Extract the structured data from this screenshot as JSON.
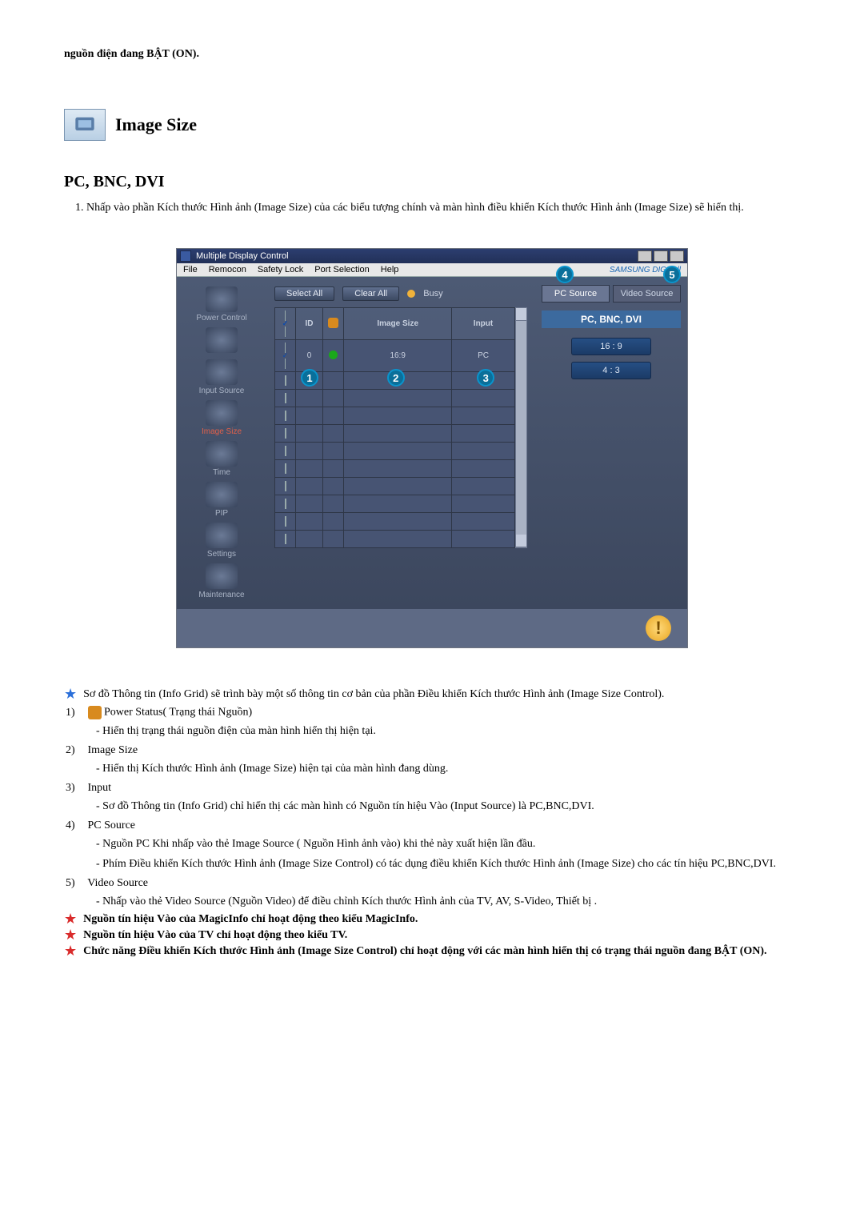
{
  "intro": "nguồn điện đang BẬT (ON).",
  "section": {
    "title": "Image Size",
    "subheading": "PC, BNC, DVI",
    "item1": "Nhấp vào phần Kích thước Hình ảnh (Image Size) của các biểu tượng chính và màn hình điều khiển Kích thước Hình ảnh (Image Size) sẽ hiển thị."
  },
  "app": {
    "title": "Multiple Display Control",
    "menus": [
      "File",
      "Remocon",
      "Safety Lock",
      "Port Selection",
      "Help"
    ],
    "brand": "SAMSUNG DIGITall",
    "sidebar": [
      {
        "label": "Power Control"
      },
      {
        "label": ""
      },
      {
        "label": "Input Source"
      },
      {
        "label": "Image Size",
        "active": true
      },
      {
        "label": "Time"
      },
      {
        "label": "PIP"
      },
      {
        "label": "Settings"
      },
      {
        "label": "Maintenance"
      }
    ],
    "buttons": {
      "select_all": "Select All",
      "clear_all": "Clear All",
      "busy": "Busy"
    },
    "grid": {
      "headers": {
        "id": "ID",
        "image_size": "Image Size",
        "input": "Input"
      },
      "row0": {
        "id": "0",
        "image_size": "16:9",
        "input": "PC"
      }
    },
    "markers": {
      "m1": "1",
      "m2": "2",
      "m3": "3",
      "m4": "4",
      "m5": "5"
    },
    "tabs": {
      "pc": "PC Source",
      "video": "Video Source"
    },
    "panel_title": "PC, BNC, DVI",
    "options": {
      "o1": "16 : 9",
      "o2": "4 : 3"
    }
  },
  "legend": {
    "intro": "Sơ đồ Thông tin (Info Grid) sẽ trình bày một số thông tin cơ bản của phần Điều khiển Kích thước Hình ảnh (Image Size Control).",
    "i1_title": "Power Status( Trạng thái Nguồn)",
    "i1_a": "Hiển thị trạng thái nguồn điện của màn hình hiển thị hiện tại.",
    "i2_title": "Image Size",
    "i2_a": "Hiển thị Kích thước Hình ảnh (Image Size) hiện tại của màn hình đang dùng.",
    "i3_title": "Input",
    "i3_a": "Sơ đồ Thông tin (Info Grid) chỉ hiển thị các màn hình có Nguồn tín hiệu Vào (Input Source) là PC,BNC,DVI.",
    "i4_title": "PC Source",
    "i4_a": "Nguồn PC Khi nhấp vào thẻ Image Source ( Nguồn Hình ảnh vào) khi thẻ này xuất hiện lần đầu.",
    "i4_b": "Phím Điều khiển Kích thước Hình ảnh (Image Size Control) có tác dụng điều khiển Kích thước Hình ảnh (Image Size) cho các tín hiệu PC,BNC,DVI.",
    "i5_title": "Video Source",
    "i5_a": "Nhấp vào thẻ Video Source (Nguồn Video) để điều chỉnh Kích thước Hình ảnh của TV, AV, S-Video, Thiết bị .",
    "n1": "Nguồn tín hiệu Vào của MagicInfo chỉ hoạt động theo kiểu MagicInfo.",
    "n2": "Nguồn tín hiệu Vào của TV chỉ hoạt động theo kiểu TV.",
    "n3": "Chức năng Điều khiển Kích thước Hình ảnh (Image Size Control) chỉ hoạt động với các màn hình hiển thị có trạng thái nguồn đang BẬT (ON)."
  }
}
